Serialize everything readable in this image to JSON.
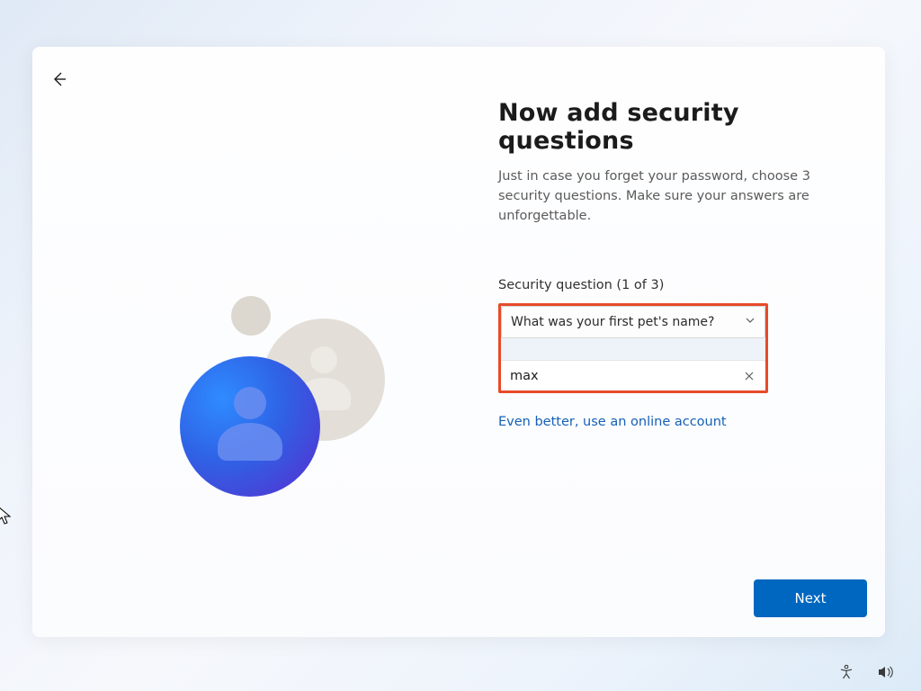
{
  "header": {
    "title": "Now add security questions",
    "subtitle": "Just in case you forget your password, choose 3 security questions. Make sure your answers are unforgettable."
  },
  "section": {
    "label": "Security question (1 of 3)"
  },
  "question_select": {
    "selected": "What was your first pet's name?"
  },
  "answer": {
    "value": "max"
  },
  "link": {
    "online_account": "Even better, use an online account"
  },
  "buttons": {
    "next": "Next"
  }
}
